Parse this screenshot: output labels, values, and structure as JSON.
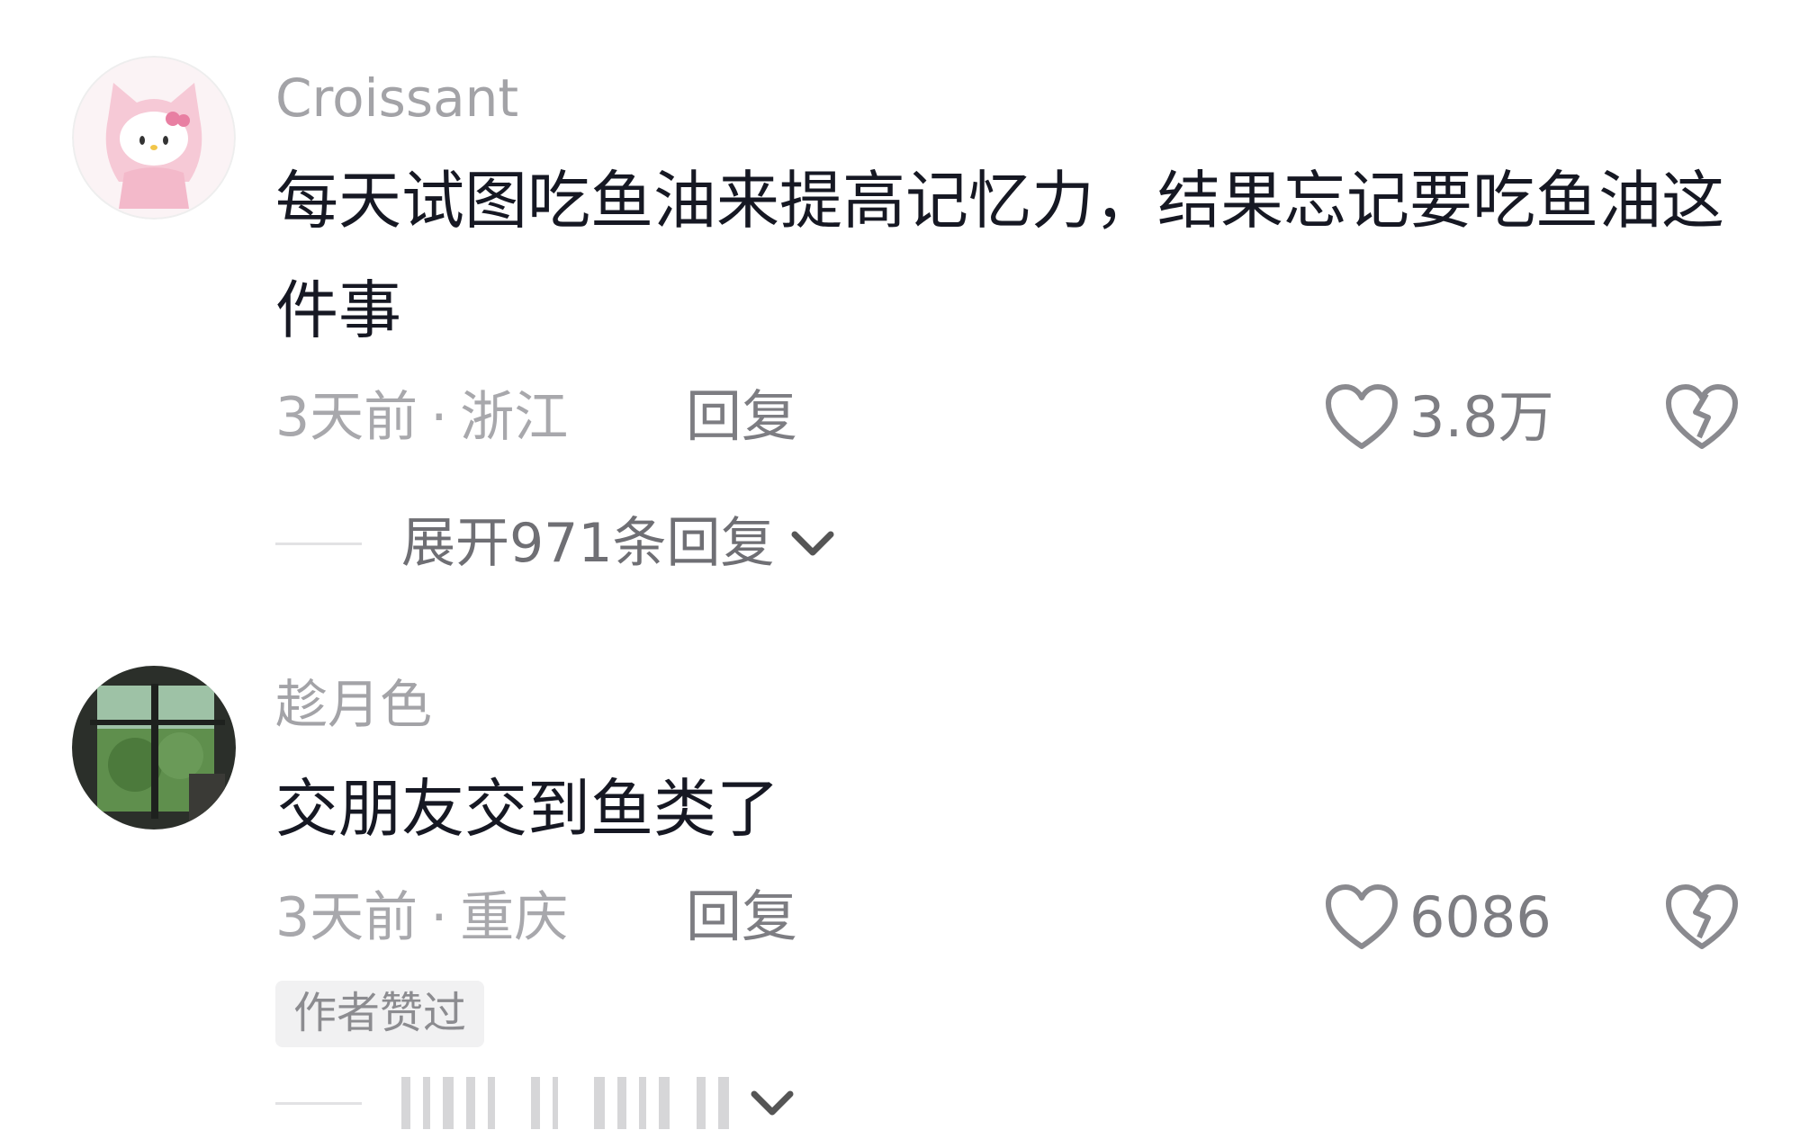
{
  "comments": [
    {
      "username": "Croissant",
      "text": "每天试图吃鱼油来提高记忆力，结果忘记要吃鱼油这件事",
      "time": "3天前",
      "location": "浙江",
      "reply_label": "回复",
      "like_count": "3.8万",
      "expand_text": "展开971条回复",
      "avatar_icon": "hello-kitty-avatar"
    },
    {
      "username": "趁月色",
      "text": "交朋友交到鱼类了",
      "time": "3天前",
      "location": "重庆",
      "reply_label": "回复",
      "like_count": "6086",
      "author_badge": "作者赞过",
      "avatar_icon": "window-scenery-avatar"
    }
  ],
  "meta_separator": "·",
  "colors": {
    "username": "#a3a3a7",
    "body": "#161823",
    "meta": "#a8a8ac",
    "icon": "#8a8a8f",
    "badge_bg": "#f1f1f2"
  }
}
